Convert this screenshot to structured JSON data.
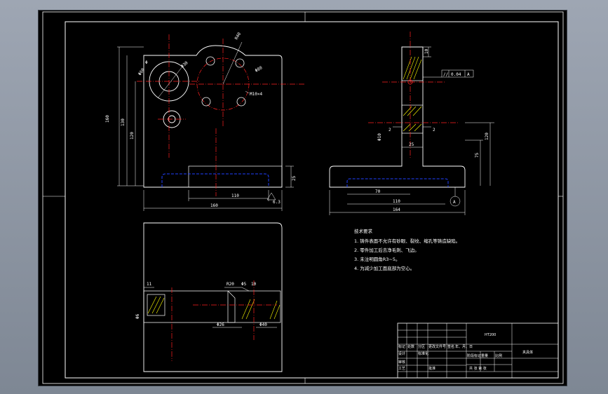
{
  "views": {
    "front": {
      "dimensions": {
        "r40": "R40",
        "phi60_top": "Φ60",
        "phi30": "Φ30",
        "phi80": "Φ80",
        "m10x4": "M10×4",
        "small_note": "Φ",
        "h160": "160",
        "h130": "130",
        "h120": "120",
        "w110": "110",
        "w160": "160",
        "h25": "25",
        "roughness": "6.3"
      }
    },
    "side": {
      "dimensions": {
        "d10": "10",
        "tolerance_symbol": "//",
        "tolerance_value": "0.04",
        "tolerance_datum": "A",
        "phi10": "Φ10",
        "gap_left": "2",
        "gap_right": "2",
        "w25": "25",
        "h120": "120",
        "h75": "75",
        "w70": "70",
        "w110": "110",
        "w164": "164",
        "datum_a": "A"
      }
    },
    "section": {
      "dimensions": {
        "d11": "11",
        "r20": "R20",
        "phi5": "Φ5",
        "d10": "10",
        "phi26": "Φ26",
        "phi40": "Φ40",
        "phi6": "Φ6"
      }
    }
  },
  "tech_requirements": {
    "title": "技术要求",
    "items": [
      "1. 铸件表面不允许有砂眼、裂纹、缩孔等铸造缺陷。",
      "2. 零件加工后去净毛刺、飞边。",
      "3. 未注明圆角R3~5。",
      "4. 为减少加工面底部为空心。"
    ]
  },
  "title_block": {
    "material": "HT200",
    "part_name": "夹具体",
    "labels": {
      "mark": "标记",
      "count": "处数",
      "zone": "分区",
      "change_doc": "更改文件号",
      "signature": "签名",
      "date": "年、月、日",
      "design": "设计",
      "standardize": "标准化",
      "stage_mark": "阶段标记",
      "weight": "重量",
      "scale": "比例",
      "review": "审核",
      "process": "工艺",
      "approve": "批准",
      "sheet_info": "共  张  第  张"
    }
  },
  "colors": {
    "background": "#000000",
    "outline": "#ffffff",
    "centerline": "#ff2020",
    "hidden": "#3050ff",
    "hatch": "#ffff00",
    "dimension": "#ffffff"
  }
}
